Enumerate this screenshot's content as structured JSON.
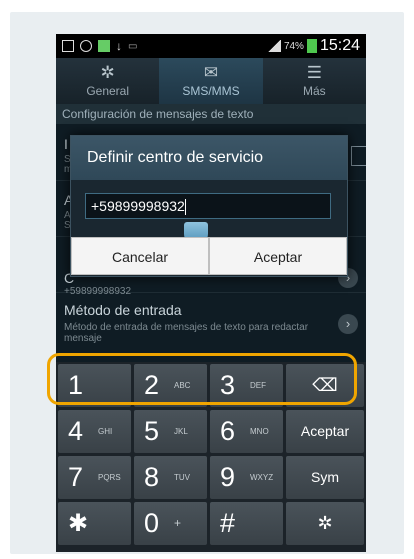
{
  "status_bar": {
    "battery_percent": "74%",
    "time": "15:24"
  },
  "tabs": [
    {
      "label": "General",
      "icon": "gear-icon"
    },
    {
      "label": "SMS/MMS",
      "icon": "message-settings-icon"
    },
    {
      "label": "Más",
      "icon": "more-settings-icon"
    }
  ],
  "section_header": "Configuración de mensajes de texto",
  "settings": {
    "partial_row_1_letter": "I",
    "partial_row_1_sub": "S",
    "partial_row_1_sub2": "m",
    "partial_row_2_letter": "A",
    "partial_row_2_sub": "A",
    "partial_row_2_sub2": "S",
    "partial_row_3_letter": "C",
    "partial_row_3_value": "+59899998932",
    "input_method_title": "Método de entrada",
    "input_method_sub": "Método de entrada de mensajes de texto para redactar mensaje"
  },
  "dialog": {
    "title": "Definir centro de servicio",
    "value": "+59899998932",
    "cancel": "Cancelar",
    "ok": "Aceptar"
  },
  "keyboard": {
    "keys": [
      {
        "digit": "1",
        "letters": ""
      },
      {
        "digit": "2",
        "letters": "ABC"
      },
      {
        "digit": "3",
        "letters": "DEF"
      },
      {
        "digit": "4",
        "letters": "GHI"
      },
      {
        "digit": "5",
        "letters": "JKL"
      },
      {
        "digit": "6",
        "letters": "MNO"
      },
      {
        "digit": "7",
        "letters": "PQRS"
      },
      {
        "digit": "8",
        "letters": "TUV"
      },
      {
        "digit": "9",
        "letters": "WXYZ"
      },
      {
        "digit": "0",
        "letters": "+"
      }
    ],
    "aceptar": "Aceptar",
    "sym": "Sym",
    "star": "✱",
    "hash": "#",
    "backspace": "⌫",
    "settings_glyph": "✲",
    "chevron": "›"
  },
  "colors": {
    "highlight": "#f0a500"
  }
}
